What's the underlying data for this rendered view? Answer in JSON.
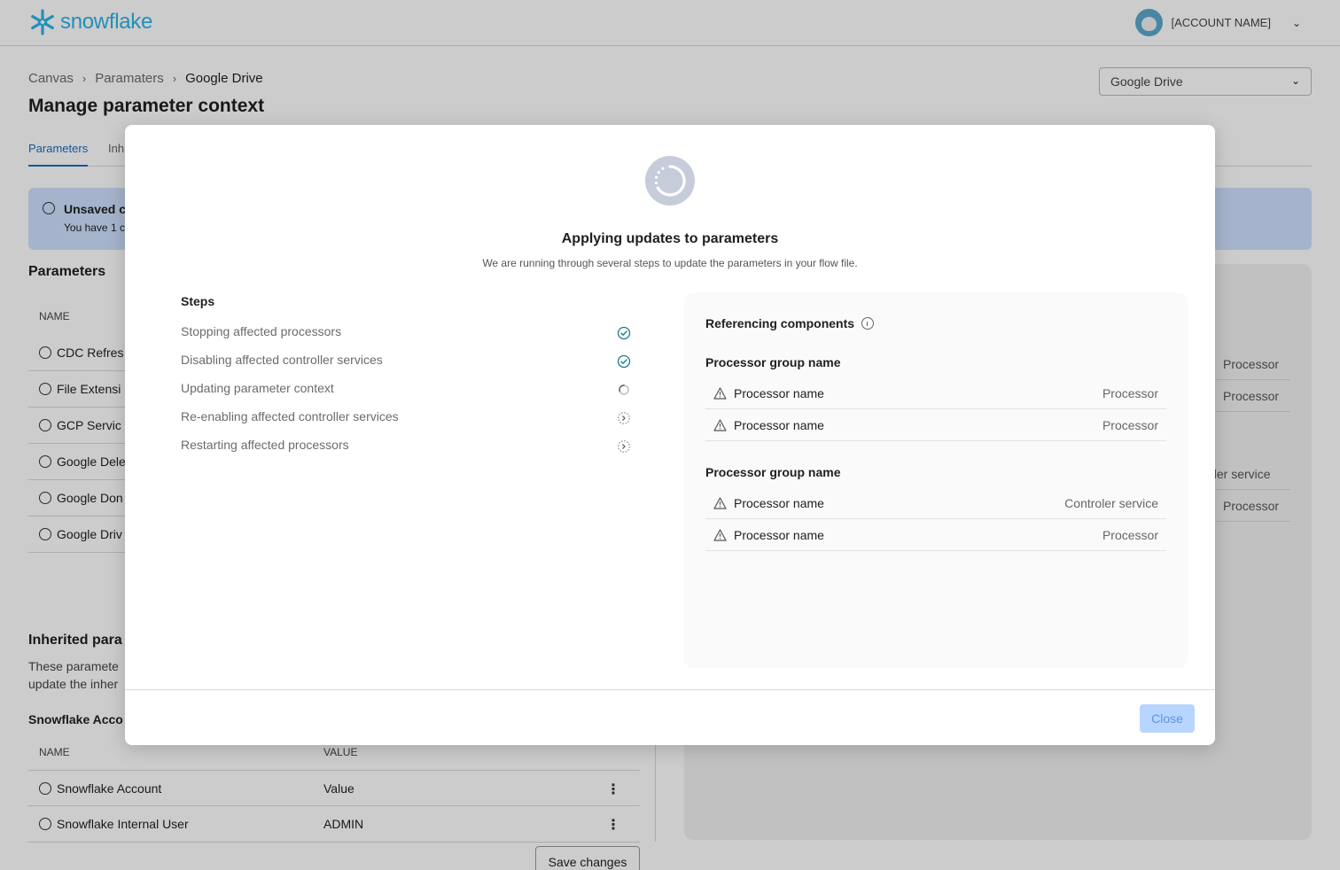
{
  "topbar": {
    "logo_text": "snowflake",
    "account_name": "[ACCOUNT NAME]"
  },
  "breadcrumb": [
    "Canvas",
    "Paramaters",
    "Google Drive"
  ],
  "page_title": "Manage parameter context",
  "context_select": {
    "value": "Google Drive"
  },
  "tabs": [
    {
      "label": "Parameters",
      "active": true
    },
    {
      "label": "Inh",
      "active": false
    }
  ],
  "banner": {
    "title": "Unsaved c",
    "text": "You have 1 c"
  },
  "parameters": {
    "title": "Parameters",
    "name_header": "NAME",
    "rows": [
      "CDC Refres",
      "File Extensi",
      "GCP Servic",
      "Google Dele",
      "Google Don",
      "Google Driv"
    ]
  },
  "right_panel": {
    "items": [
      "Processor",
      "Processor",
      "oler service",
      "Processor"
    ]
  },
  "inherited": {
    "title": "Inherited para",
    "desc_line1": "These paramete",
    "desc_line2": "update the inher",
    "subsection": "Snowflake Acco",
    "name_header": "NAME",
    "value_header": "VALUE",
    "rows": [
      {
        "name": "Snowflake Account",
        "value": "Value"
      },
      {
        "name": "Snowflake Internal User",
        "value": "ADMIN"
      }
    ],
    "save_label": "Save changes"
  },
  "modal": {
    "title": "Applying updates to parameters",
    "subtitle": "We are running through several steps to update the parameters in your flow file.",
    "steps_title": "Steps",
    "steps": [
      {
        "label": "Stopping affected processors",
        "status": "done"
      },
      {
        "label": "Disabling affected controller services",
        "status": "done"
      },
      {
        "label": "Updating parameter context",
        "status": "in-progress"
      },
      {
        "label": "Re-enabling affected controller services",
        "status": "pending"
      },
      {
        "label": "Restarting affected processors",
        "status": "pending"
      }
    ],
    "referencing": {
      "title": "Referencing components",
      "groups": [
        {
          "name": "Processor group name",
          "rows": [
            {
              "name": "Processor name",
              "type": "Processor"
            },
            {
              "name": "Processor name",
              "type": "Processor"
            }
          ]
        },
        {
          "name": "Processor group name",
          "rows": [
            {
              "name": "Processor name",
              "type": "Controler service"
            },
            {
              "name": "Processor name",
              "type": "Processor"
            }
          ]
        }
      ]
    },
    "close_label": "Close"
  },
  "colors": {
    "brand": "#29b5e8",
    "accent": "#1a6dbf",
    "done": "#1f7a8c",
    "close_disabled_bg": "#b7d5ff"
  }
}
